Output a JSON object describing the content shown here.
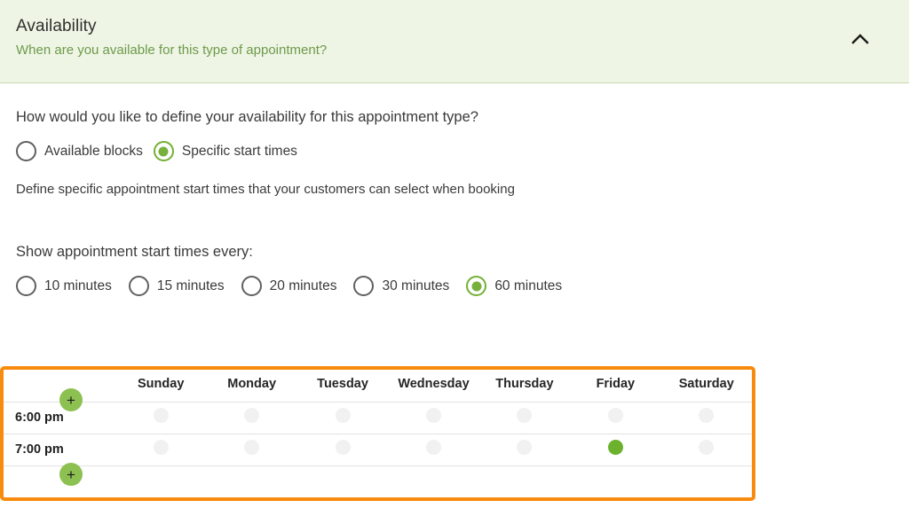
{
  "header": {
    "title": "Availability",
    "subtitle": "When are you available for this type of appointment?",
    "collapse_icon": "chevron-up-icon",
    "background": "#eef5e4",
    "subtitle_color": "#6e9a4c"
  },
  "main": {
    "question": "How would you like to define your availability for this appointment type?",
    "mode_options": [
      {
        "label": "Available blocks",
        "selected": false
      },
      {
        "label": "Specific start times",
        "selected": true
      }
    ],
    "helper_text": "Define specific appointment start times that your customers can select when booking",
    "interval_label": "Show appointment start times every:",
    "interval_options": [
      {
        "label": "10 minutes",
        "selected": false
      },
      {
        "label": "15 minutes",
        "selected": false
      },
      {
        "label": "20 minutes",
        "selected": false
      },
      {
        "label": "30 minutes",
        "selected": false
      },
      {
        "label": "60 minutes",
        "selected": true
      }
    ]
  },
  "schedule": {
    "highlight_color": "#f78b0e",
    "selected_slot_color": "#6cb22e",
    "empty_slot_color": "#f1f1f1",
    "add_button_label": "+",
    "add_row_top_name": "add-time-row-above-button",
    "add_row_bottom_name": "add-time-row-below-button",
    "days": [
      "Sunday",
      "Monday",
      "Tuesday",
      "Wednesday",
      "Thursday",
      "Friday",
      "Saturday"
    ],
    "rows": [
      {
        "time": "6:00 pm",
        "slots": [
          false,
          false,
          false,
          false,
          false,
          false,
          false
        ]
      },
      {
        "time": "7:00 pm",
        "slots": [
          false,
          false,
          false,
          false,
          false,
          true,
          false
        ]
      }
    ]
  }
}
